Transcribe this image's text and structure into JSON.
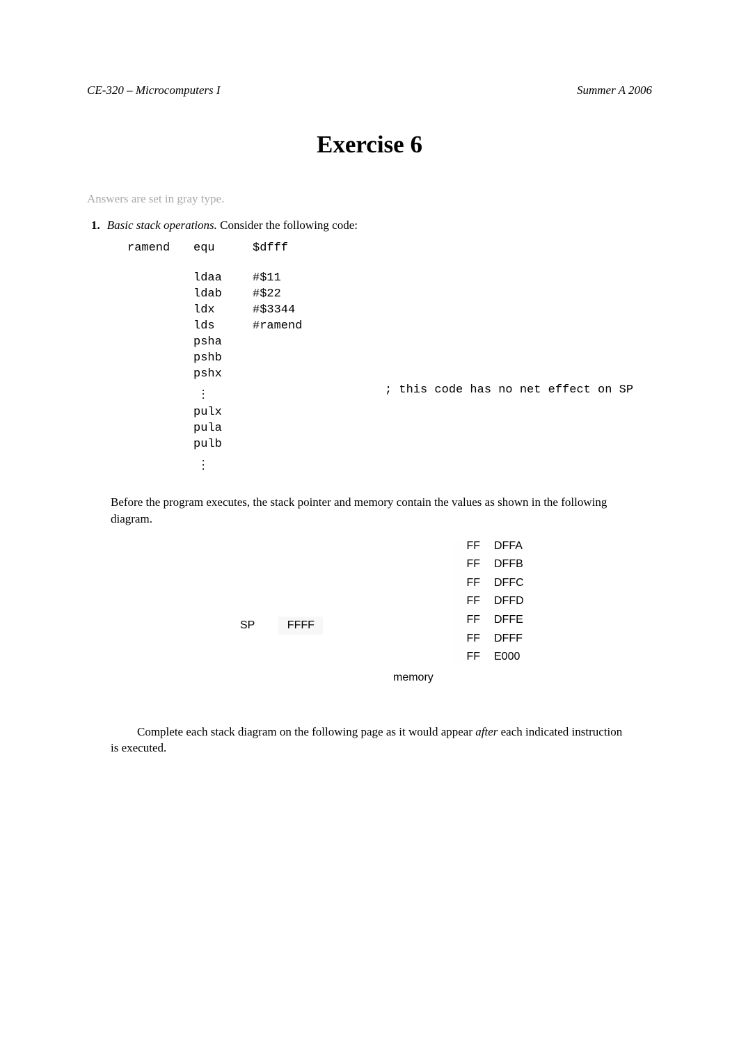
{
  "header": {
    "left": "CE-320 – Microcomputers I",
    "right": "Summer A 2006"
  },
  "title": "Exercise 6",
  "gray_note": "Answers are set in gray type.",
  "question": {
    "number": "1.",
    "lead_italic": "Basic stack operations.",
    "rest": " Consider the following code:"
  },
  "code": {
    "lines": [
      {
        "label": "ramend",
        "mnem": "equ",
        "arg": "$dfff",
        "cmt": ""
      },
      {
        "label": "",
        "mnem": "",
        "arg": "",
        "cmt": ""
      },
      {
        "label": "",
        "mnem": "ldaa",
        "arg": "#$11",
        "cmt": ""
      },
      {
        "label": "",
        "mnem": "ldab",
        "arg": "#$22",
        "cmt": ""
      },
      {
        "label": "",
        "mnem": "ldx",
        "arg": "#$3344",
        "cmt": ""
      },
      {
        "label": "",
        "mnem": "lds",
        "arg": "#ramend",
        "cmt": ""
      },
      {
        "label": "",
        "mnem": "psha",
        "arg": "",
        "cmt": ""
      },
      {
        "label": "",
        "mnem": "pshb",
        "arg": "",
        "cmt": ""
      },
      {
        "label": "",
        "mnem": "pshx",
        "arg": "",
        "cmt": ""
      }
    ],
    "comment": "; this code has no net effect on SP",
    "lines_after": [
      {
        "label": "",
        "mnem": "pulx",
        "arg": "",
        "cmt": ""
      },
      {
        "label": "",
        "mnem": "pula",
        "arg": "",
        "cmt": ""
      },
      {
        "label": "",
        "mnem": "pulb",
        "arg": "",
        "cmt": ""
      }
    ],
    "vdots": "."
  },
  "para1": "Before the program executes, the stack pointer and memory contain the values as shown in the following diagram.",
  "diagram": {
    "sp_label": "SP",
    "sp_value": "FFFF",
    "memory_label": "memory",
    "rows": [
      {
        "val": "FF",
        "addr": "DFFA"
      },
      {
        "val": "FF",
        "addr": "DFFB"
      },
      {
        "val": "FF",
        "addr": "DFFC"
      },
      {
        "val": "FF",
        "addr": "DFFD"
      },
      {
        "val": "FF",
        "addr": "DFFE"
      },
      {
        "val": "FF",
        "addr": "DFFF"
      },
      {
        "val": "FF",
        "addr": "E000"
      }
    ]
  },
  "para2_a": "Complete each stack diagram on the following page as it would appear ",
  "para2_ital": "after",
  "para2_b": " each indicated instruction is executed."
}
